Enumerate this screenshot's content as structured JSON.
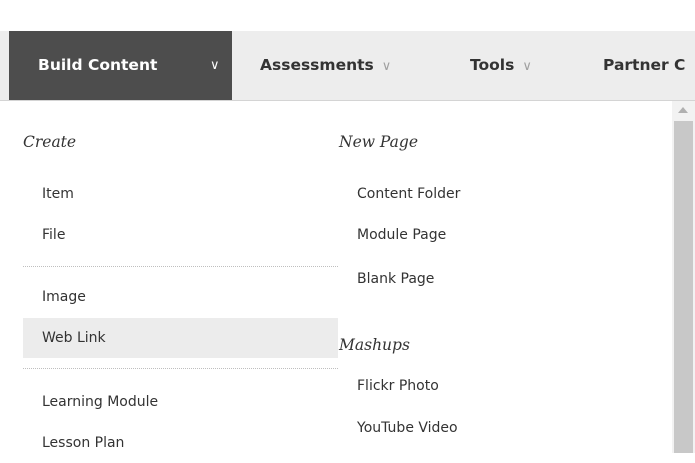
{
  "toolbar": {
    "build_content": "Build Content",
    "assessments": "Assessments",
    "tools": "Tools",
    "partner": "Partner C",
    "chevron": "∨"
  },
  "menu": {
    "create": {
      "heading": "Create",
      "group1": [
        "Item",
        "File"
      ],
      "group2": [
        "Image",
        "Web Link"
      ],
      "group3": [
        "Learning Module",
        "Lesson Plan"
      ]
    },
    "new_page": {
      "heading": "New Page",
      "items": [
        "Content Folder",
        "Module Page",
        "Blank Page"
      ]
    },
    "mashups": {
      "heading": "Mashups",
      "items": [
        "Flickr Photo",
        "YouTube Video"
      ]
    },
    "highlighted_item": "Web Link"
  },
  "colors": {
    "active_tab_bg": "#4d4d4d",
    "toolbar_bg": "#ededed",
    "highlight_bg": "#ececec"
  }
}
